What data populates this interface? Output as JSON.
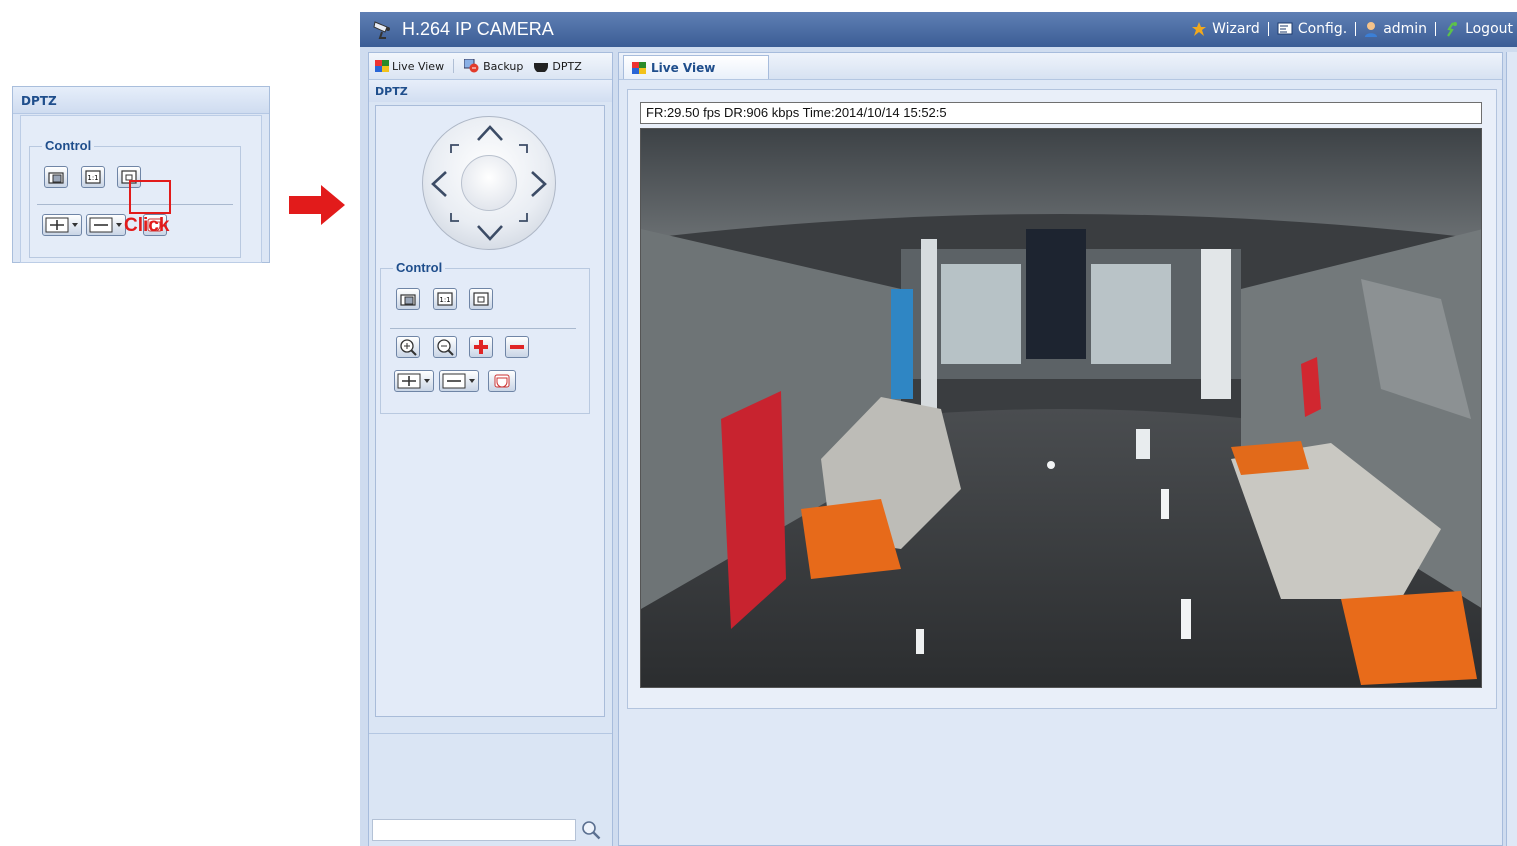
{
  "callout": {
    "title": "DPTZ",
    "control_legend": "Control",
    "click_label": "Click",
    "highlight_color": "#e21b1b"
  },
  "app": {
    "title": "H.264 IP CAMERA",
    "nav": {
      "wizard": "Wizard",
      "config": "Config.",
      "user": "admin",
      "logout": "Logout"
    },
    "left_tabs": {
      "live_view": "Live View",
      "backup": "Backup",
      "dptz": "DPTZ"
    },
    "dptz_panel": {
      "title": "DPTZ",
      "control_legend": "Control"
    },
    "search": {
      "value": ""
    },
    "right_tab": {
      "label": "Live View"
    },
    "video": {
      "status": "FR:29.50 fps  DR:906 kbps Time:2014/10/14 15:52:5"
    }
  },
  "colors": {
    "titlebar": "#4a6ca6",
    "panel_bg": "#dae5f4",
    "accent_text": "#1f4e8c"
  },
  "icons": {
    "snapshot": "camera-snapshot-icon",
    "original_size": "one-to-one-icon",
    "fit_window": "fit-window-icon",
    "zoom_in": "zoom-in-icon",
    "zoom_out": "zoom-out-icon",
    "add": "plus-icon",
    "remove": "minus-icon",
    "preset": "preset-dropdown-icon",
    "cruise": "cruise-dropdown-icon",
    "dewarp": "dewarp-icon"
  }
}
